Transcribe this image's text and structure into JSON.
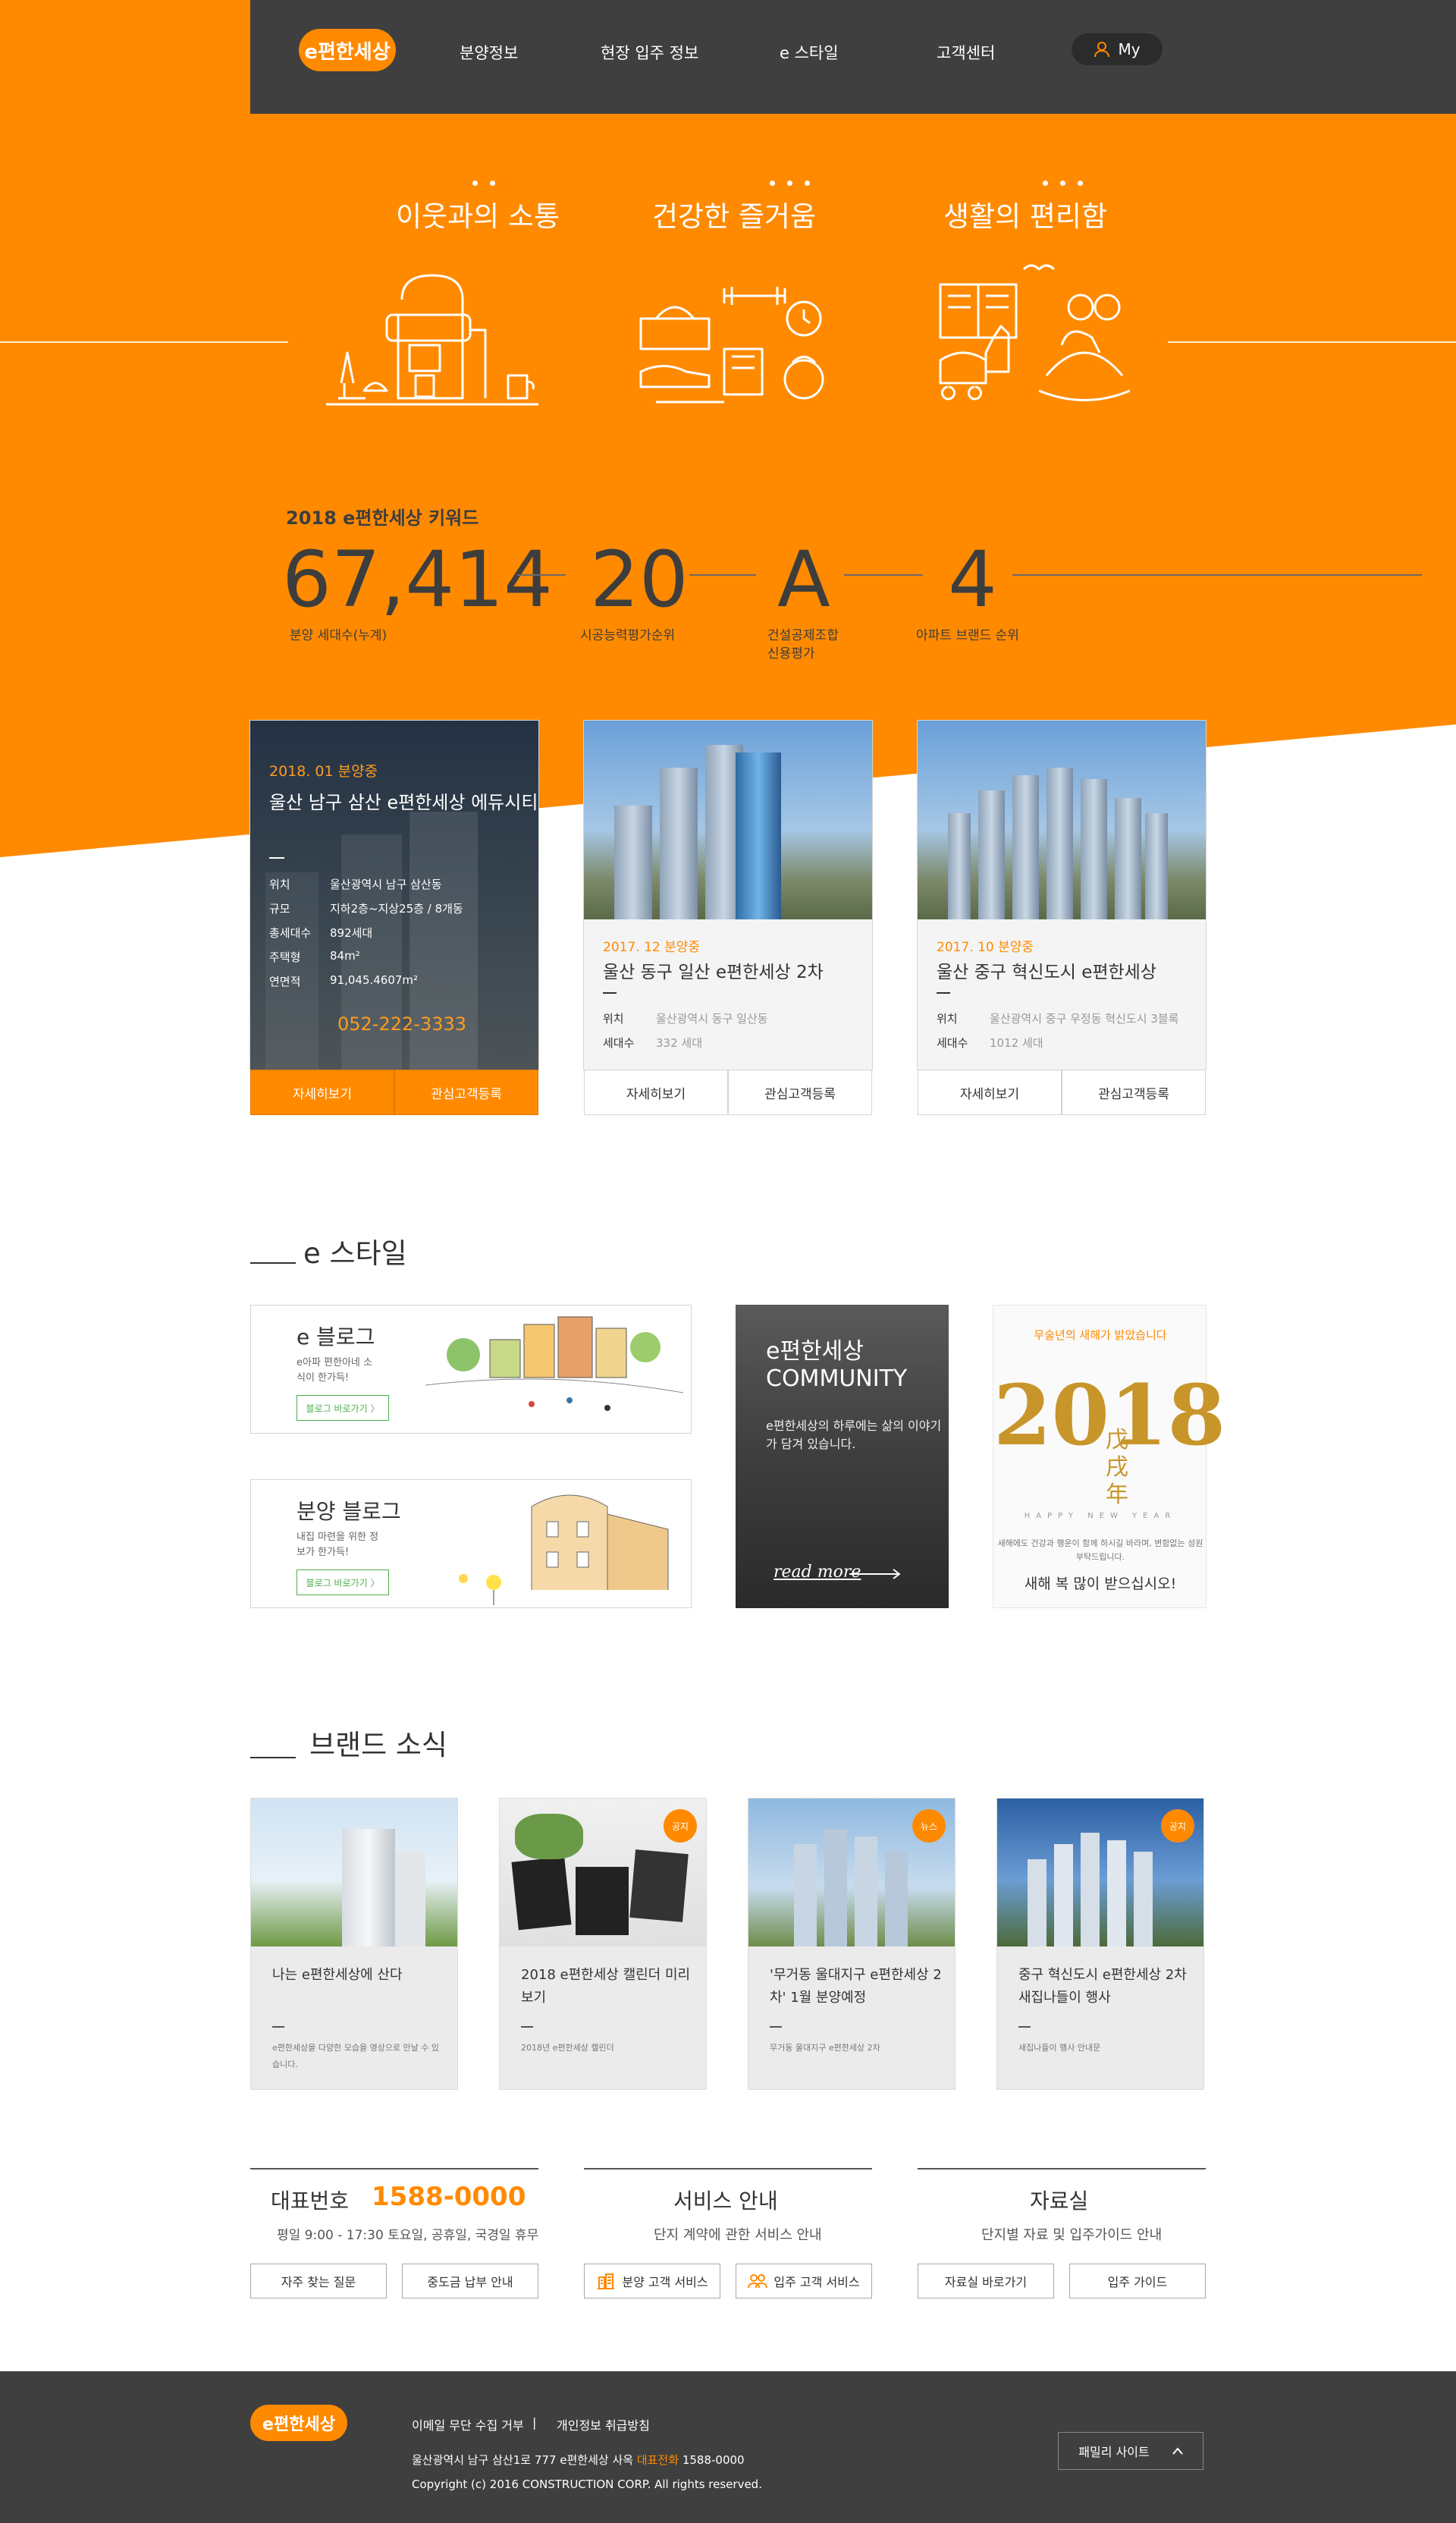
{
  "brand": {
    "logo_text": "e편한세상",
    "accent": "#ff8a00",
    "dark": "#3f3f3f"
  },
  "nav": {
    "items": [
      "분양정보",
      "현장 입주 정보",
      "e 스타일",
      "고객센터"
    ],
    "my_label": "My"
  },
  "hero": {
    "concepts": [
      {
        "title": "이웃과의 소통",
        "icon": "coffee-machine-icon"
      },
      {
        "title": "건강한 즐거움",
        "icon": "fitness-icon"
      },
      {
        "title": "생활의 편리함",
        "icon": "family-life-icon"
      }
    ]
  },
  "keywords": {
    "title": "2018 e편한세상 키워드",
    "items": [
      {
        "value": "67,414",
        "label": "분양 세대수(누계)"
      },
      {
        "value": "20",
        "label": "시공능력평가순위"
      },
      {
        "value": "A",
        "label": "건설공제조합\n신용평가"
      },
      {
        "value": "4",
        "label": "아파트 브랜드 순위"
      }
    ]
  },
  "projects": [
    {
      "tag": "2018. 01 분양중",
      "title": "울산 남구 삼산 e편한세상 에듀시티",
      "rows": [
        {
          "k": "위치",
          "v": "울산광역시 남구 삼산동"
        },
        {
          "k": "규모",
          "v": "지하2층~지상25층 / 8개동"
        },
        {
          "k": "총세대수",
          "v": "892세대"
        },
        {
          "k": "주택형",
          "v": "84m²"
        },
        {
          "k": "연면적",
          "v": "91,045.4607m²"
        }
      ],
      "phone": "052-222-3333",
      "btn_detail": "자세히보기",
      "btn_register": "관심고객등록"
    },
    {
      "tag": "2017. 12 분양중",
      "title": "울산 동구 일산 e편한세상 2차",
      "rows": [
        {
          "k": "위치",
          "v": "울산광역시 동구 일산동"
        },
        {
          "k": "세대수",
          "v": "332 세대"
        }
      ],
      "btn_detail": "자세히보기",
      "btn_register": "관심고객등록"
    },
    {
      "tag": "2017. 10 분양중",
      "title": "울산 중구  혁신도시 e편한세상",
      "rows": [
        {
          "k": "위치",
          "v": "울산광역시 중구 우정동 혁신도시 3블록"
        },
        {
          "k": "세대수",
          "v": "1012 세대"
        }
      ],
      "btn_detail": "자세히보기",
      "btn_register": "관심고객등록"
    }
  ],
  "estyle": {
    "title": "e 스타일",
    "blog1": {
      "title": "e 블로그",
      "desc": "e아파 편한아네 소식이 한가득!",
      "btn": "블로그 바로가기  〉"
    },
    "blog2": {
      "title": "분양 블로그",
      "desc": "내집 마련을 위한 정보가 한가득!",
      "btn": "블로그 바로가기  〉"
    },
    "community": {
      "title1": "e편한세상",
      "title2": "COMMUNITY",
      "desc": "e편한세상의 하루에는 삶의 이야기가 담겨 있습니다.",
      "readmore": "read more"
    },
    "newyear": {
      "top": "무술년의 새해가 밝았습니다",
      "year": "2018",
      "chinese": "戊戌年",
      "hny": "HAPPY NEW YEAR",
      "msg": "새해에도 건강과 행운이 함께 하시길 바라며, 변함없는 성원 부탁드립니다.",
      "bow": "새해 복 많이 받으십시오!"
    }
  },
  "brandnews": {
    "title": "브랜드 소식",
    "items": [
      {
        "title": "나는 e편한세상에 산다",
        "desc": "e편한세상을 다양한 모습을 영상으로 만날 수 있습니다.",
        "badge": ""
      },
      {
        "title": "2018 e편한세상 캘린더 미리보기",
        "desc": "2018년 e편한세상 캘린더",
        "badge": "공지"
      },
      {
        "title": "'무거동 울대지구 e편한세상 2차' 1월 분양예정",
        "desc": "무거동 울대지구 e편한세상 2차",
        "badge": "뉴스"
      },
      {
        "title": "중구 혁신도시 e편한세상 2차 새집나들이 행사",
        "desc": "새집나들이 행사 안내문",
        "badge": "공지"
      }
    ]
  },
  "info": {
    "phone_title": "대표번호",
    "phone": "1588-0000",
    "hours": "평일 9:00 - 17:30 토요일, 공휴일, 국경일 휴무",
    "btn_faq": "자주 찾는 질문",
    "btn_payment": "중도금 납부 안내",
    "service_title": "서비스 안내",
    "service_sub": "단지 계약에 관한 서비스 안내",
    "btn_sale": "분양 고객 서비스",
    "btn_move": "입주 고객 서비스",
    "archive_title": "자료실",
    "archive_sub": "단지별 자료 및 입주가이드 안내",
    "btn_archive": "자료실 바로가기",
    "btn_guide": "입주 가이드"
  },
  "footer": {
    "logo": "e편한세상",
    "link1": "이메일 무단 수집 거부",
    "divider": "|",
    "link2": "개인정보 취급방침",
    "address": "울산광역시 남구 삼산1로 777 e편한세상 사옥",
    "phone_label": "대표전화",
    "phone": "1588-0000",
    "copyright": "Copyright (c) 2016 CONSTRUCTION CORP. All rights reserved.",
    "family": "패밀리 사이트"
  }
}
